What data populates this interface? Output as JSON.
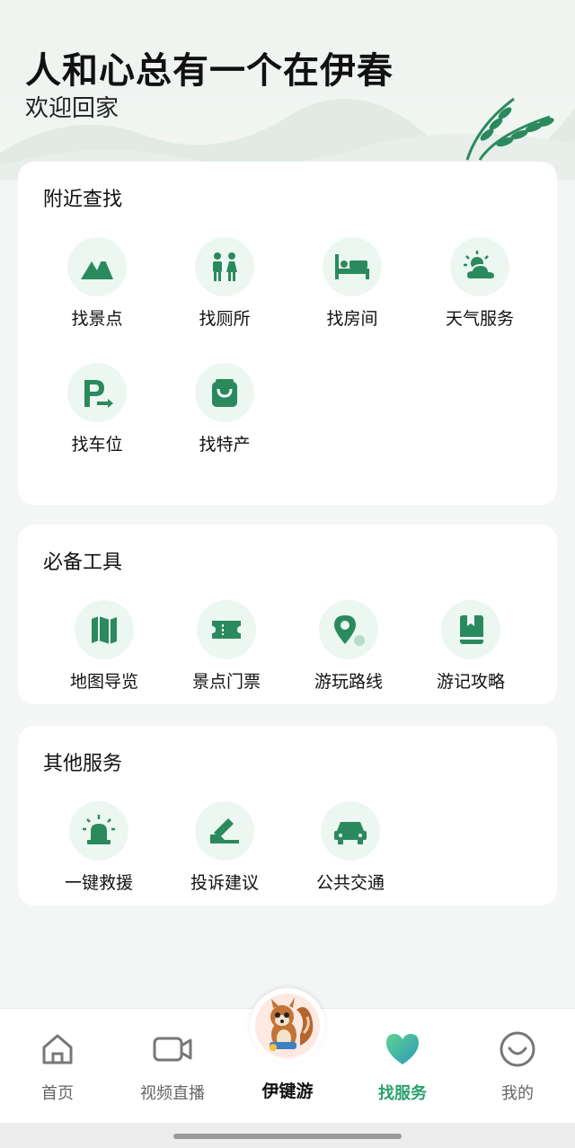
{
  "header": {
    "title": "人和心总有一个在伊春",
    "subtitle": "欢迎回家"
  },
  "colors": {
    "accent": "#2a8a5e",
    "icon_bg": "#edf7f1",
    "active_tab": "#27a06b"
  },
  "sections": [
    {
      "title": "附近查找",
      "items": [
        {
          "label": "找景点",
          "icon": "mountain-icon"
        },
        {
          "label": "找厕所",
          "icon": "restroom-icon"
        },
        {
          "label": "找房间",
          "icon": "bed-icon"
        },
        {
          "label": "天气服务",
          "icon": "weather-icon"
        },
        {
          "label": "找车位",
          "icon": "parking-icon"
        },
        {
          "label": "找特产",
          "icon": "shopping-bag-icon"
        }
      ]
    },
    {
      "title": "必备工具",
      "items": [
        {
          "label": "地图导览",
          "icon": "map-icon"
        },
        {
          "label": "景点门票",
          "icon": "ticket-icon"
        },
        {
          "label": "游玩路线",
          "icon": "route-pin-icon"
        },
        {
          "label": "游记攻略",
          "icon": "book-icon"
        }
      ]
    },
    {
      "title": "其他服务",
      "items": [
        {
          "label": "一键救援",
          "icon": "alarm-light-icon"
        },
        {
          "label": "投诉建议",
          "icon": "feedback-icon"
        },
        {
          "label": "公共交通",
          "icon": "car-icon"
        }
      ]
    }
  ],
  "tabbar": {
    "tabs": [
      {
        "label": "首页",
        "icon": "home-icon"
      },
      {
        "label": "视频直播",
        "icon": "video-icon"
      },
      {
        "label": "伊键游",
        "icon": "squirrel-mascot-icon"
      },
      {
        "label": "找服务",
        "icon": "heart-icon",
        "active": true
      },
      {
        "label": "我的",
        "icon": "smiley-icon"
      }
    ]
  }
}
